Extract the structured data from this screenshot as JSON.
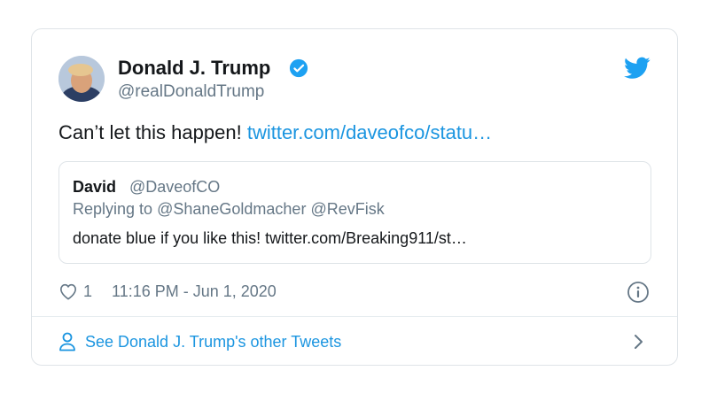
{
  "tweet": {
    "author_name": "Donald J. Trump",
    "author_handle": "@realDonaldTrump",
    "text": "Can’t let this happen!",
    "link_text": "twitter.com/daveofco/statu…",
    "quote": {
      "name": "David",
      "handle": "@DaveofCO",
      "replying_prefix": "Replying to",
      "replying_to": [
        "@ShaneGoldmacher",
        "@RevFisk"
      ],
      "text": "donate blue if you like this! twitter.com/Breaking911/st…"
    },
    "like_count": "1",
    "timestamp": "11:16 PM - Jun 1, 2020",
    "footer_link": "See Donald J. Trump's other Tweets"
  },
  "icons": {
    "verified": "verified-badge-icon",
    "logo": "twitter-bird-icon",
    "like": "heart-icon",
    "info": "info-icon",
    "profile": "person-icon",
    "next": "chevron-right-icon"
  },
  "colors": {
    "accent": "#1b95e0",
    "verified": "#1da1f2",
    "text": "#14171a",
    "muted": "#657786",
    "border": "#dfe4e8"
  }
}
